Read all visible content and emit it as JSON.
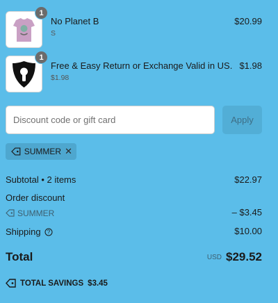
{
  "line_items": [
    {
      "title": "No Planet B",
      "subtitle": "S",
      "price": "$20.99",
      "quantity": "1",
      "thumb_icon": "pink-tshirt-image"
    },
    {
      "title": "Free & Easy Return or Exchange Valid in US.",
      "subtitle": "$1.98",
      "price": "$1.98",
      "quantity": "1",
      "thumb_icon": "keyhole-shield-image"
    }
  ],
  "discount": {
    "placeholder": "Discount code or gift card",
    "apply_label": "Apply",
    "applied_code": "SUMMER"
  },
  "summary": {
    "subtotal_label": "Subtotal • 2 items",
    "subtotal_value": "$22.97",
    "order_discount_label": "Order discount",
    "discount_code": "SUMMER",
    "discount_value": "– $3.45",
    "shipping_label": "Shipping",
    "shipping_value": "$10.00",
    "total_label": "Total",
    "currency": "USD",
    "total_value": "$29.52",
    "savings_label": "TOTAL SAVINGS",
    "savings_value": "$3.45"
  },
  "colors": {
    "background": "#5bbde9",
    "apply_bg": "#52aed6",
    "chip_bg": "#4ea7cf"
  }
}
